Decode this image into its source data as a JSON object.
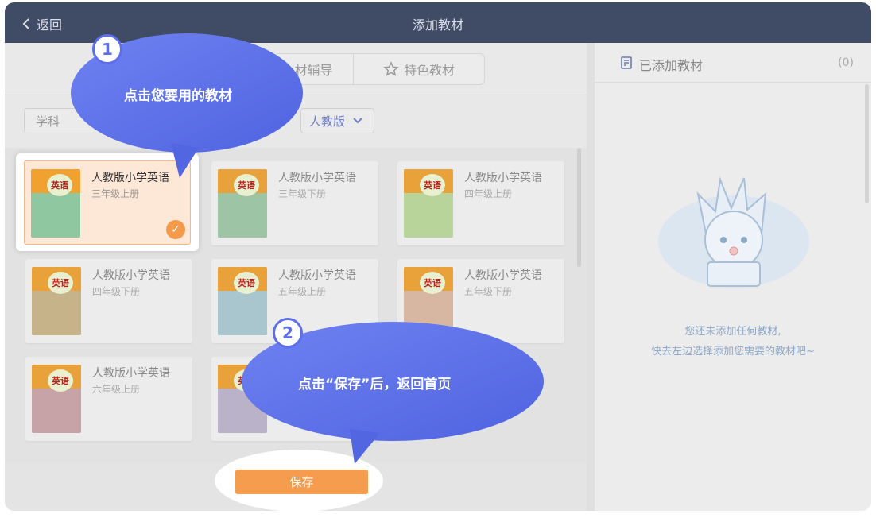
{
  "titlebar": {
    "back_label": "返回",
    "title": "添加教材"
  },
  "tabs": {
    "tab1_label": "材辅导",
    "tab2_label": "特色教材"
  },
  "filters": {
    "subject_label": "学科",
    "edition_label": "人教版"
  },
  "books": [
    {
      "name": "人教版小学英语",
      "grade": "三年级上册",
      "cover_label": "英语",
      "selected": true
    },
    {
      "name": "人教版小学英语",
      "grade": "三年级下册",
      "cover_label": "英语"
    },
    {
      "name": "人教版小学英语",
      "grade": "四年级上册",
      "cover_label": "英语"
    },
    {
      "name": "人教版小学英语",
      "grade": "四年级下册",
      "cover_label": "英语"
    },
    {
      "name": "人教版小学英语",
      "grade": "五年级上册",
      "cover_label": "英语"
    },
    {
      "name": "人教版小学英语",
      "grade": "五年级下册",
      "cover_label": "英语"
    },
    {
      "name": "人教版小学英语",
      "grade": "六年级上册",
      "cover_label": "英语"
    },
    {
      "name": "",
      "grade": "",
      "cover_label": "英语"
    }
  ],
  "save_label": "保存",
  "added_panel": {
    "title": "已添加教材",
    "count": "(0)",
    "empty_line1": "您还未添加任何教材,",
    "empty_line2": "快去左边选择添加您需要的教材吧~"
  },
  "callouts": [
    {
      "number": "1",
      "text": "点击您要用的教材"
    },
    {
      "number": "2",
      "text": "点击“保存”后，返回首页"
    }
  ],
  "colors": {
    "titlebar": "#404b66",
    "accent_orange": "#f59c4e",
    "callout_blue": "#5c6fe8",
    "edition_blue": "#6f7fcc"
  }
}
